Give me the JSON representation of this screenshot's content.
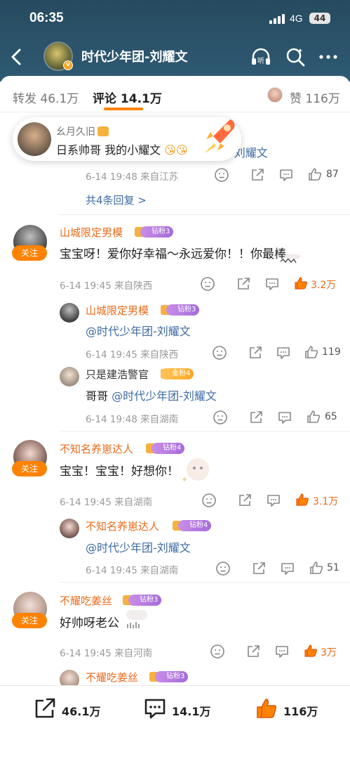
{
  "status_bar": {
    "time": "06:35",
    "network": "4G",
    "battery": "44"
  },
  "header": {
    "title": "时代少年团-刘耀文",
    "verified_icon": "v-badge-icon",
    "icons": [
      "back-arrow-icon",
      "listen-icon",
      "search-icon",
      "more-icon"
    ],
    "listen_label": "听"
  },
  "tabs": {
    "repost": "转发 46.1万",
    "comments": "评论 14.1万",
    "likes": "赞 116万"
  },
  "toast": {
    "name": "幺月久旧",
    "text": "日系帅哥 我的小耀文"
  },
  "reply_block_top": {
    "partial_text": "@时代少年团-刘耀文",
    "meta": "6-14 19:48 来自江苏",
    "like_count": "87",
    "more_replies": "共4条回复 >"
  },
  "comments": [
    {
      "name": "山城限定男模",
      "badge": "钻粉3",
      "follow": "关注",
      "text": "宝宝呀！爱你好幸福～永远爱你！！你最棒",
      "meta": "6-14 19:45 来自陕西",
      "like_count": "3.2万",
      "replies": [
        {
          "name": "山城限定男模",
          "badge": "钻粉3",
          "text": "@时代少年团-刘耀文",
          "meta": "6-14 19:45 来自陕西",
          "like_count": "119"
        },
        {
          "name": "只是建浩警官",
          "badge": "金粉4",
          "text_prefix": "哥哥 ",
          "mention": "@时代少年团-刘耀文",
          "meta": "6-14 19:48 来自湖南",
          "like_count": "65"
        }
      ]
    },
    {
      "name": "不知名养崽达人",
      "badge": "钻粉4",
      "follow": "关注",
      "text": "宝宝！宝宝！好想你！",
      "meta": "6-14 19:45 来自湖南",
      "like_count": "3.1万",
      "replies": [
        {
          "name": "不知名养崽达人",
          "badge": "钻粉4",
          "text": "@时代少年团-刘耀文",
          "meta": "6-14 19:45 来自湖南",
          "like_count": "51"
        }
      ]
    },
    {
      "name": "不耀吃姜丝",
      "badge": "钻粉3",
      "follow": "关注",
      "text": "好帅呀老公",
      "meta": "6-14 19:45 来自河南",
      "like_count": "3万",
      "replies": [
        {
          "name": "不耀吃姜丝",
          "badge": "钻粉3"
        }
      ]
    }
  ],
  "bottom_bar": {
    "repost": "46.1万",
    "comment": "14.1万",
    "like": "116万"
  },
  "colors": {
    "accent": "#ff8200",
    "name": "#e86b1c",
    "mention": "#3f6ba3",
    "header_bg": "#2e5a73"
  }
}
